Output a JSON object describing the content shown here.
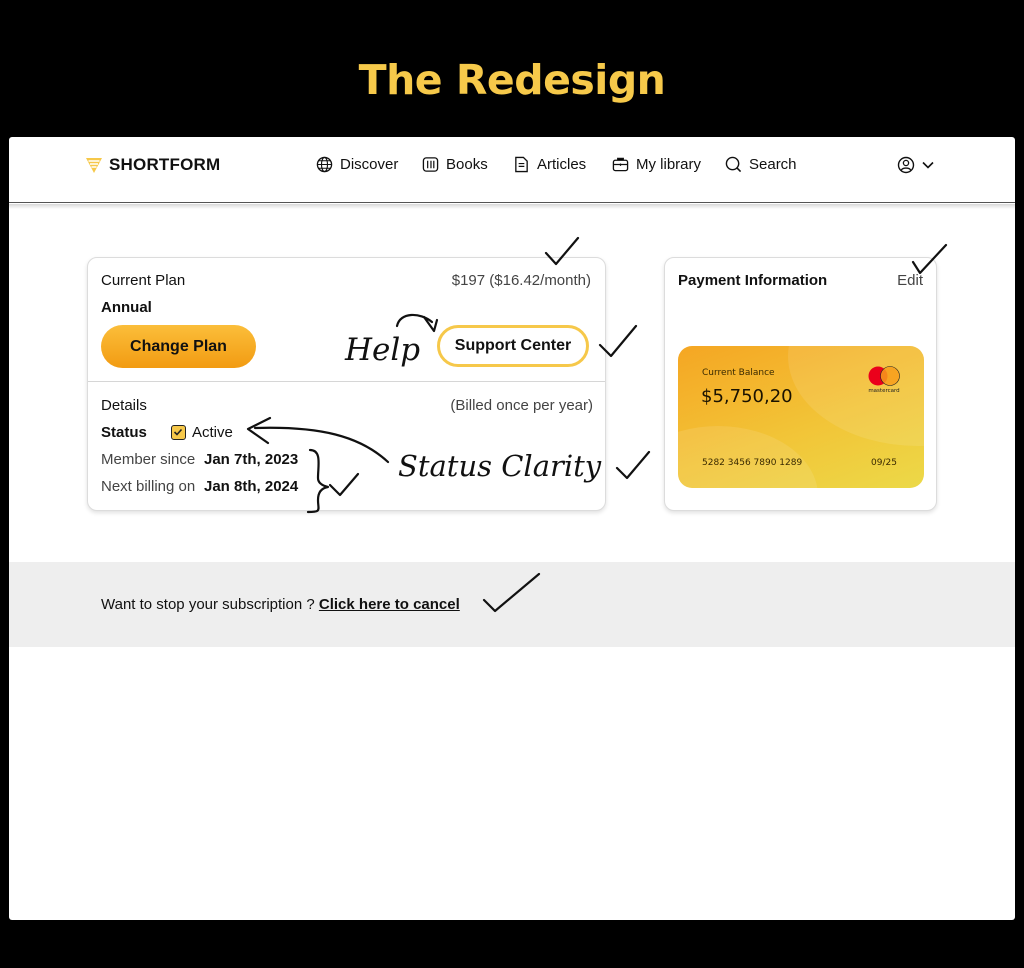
{
  "headline": "The Redesign",
  "brand": {
    "name": "SHORTFORM",
    "accent": "#f6c84a"
  },
  "nav": {
    "items": [
      {
        "label": "Discover",
        "icon": "globe-icon"
      },
      {
        "label": "Books",
        "icon": "book-icon"
      },
      {
        "label": "Articles",
        "icon": "article-icon"
      },
      {
        "label": "My library",
        "icon": "briefcase-icon"
      },
      {
        "label": "Search",
        "icon": "search-icon"
      }
    ],
    "user_icon": "user-circle-icon"
  },
  "plan": {
    "label": "Current Plan",
    "price": "$197 ($16.42/month)",
    "type": "Annual",
    "change_button": "Change Plan",
    "support_button": "Support Center",
    "details_label": "Details",
    "billing_note": "(Billed once per year)",
    "status_label": "Status",
    "status_value": "Active",
    "member_since_label": "Member since",
    "member_since_date": "Jan 7th, 2023",
    "next_billing_label": "Next billing on",
    "next_billing_date": "Jan 8th, 2024"
  },
  "payment": {
    "title": "Payment Information",
    "edit": "Edit",
    "card": {
      "balance_label": "Current Balance",
      "balance": "$5,750,20",
      "number": "5282 3456 7890 1289",
      "expiry": "09/25",
      "network": "mastercard"
    }
  },
  "cancel": {
    "question": "Want to stop your subscription ?",
    "link": "Click here to cancel"
  },
  "annotations": {
    "help": "Help",
    "status_clarity": "Status Clarity"
  }
}
